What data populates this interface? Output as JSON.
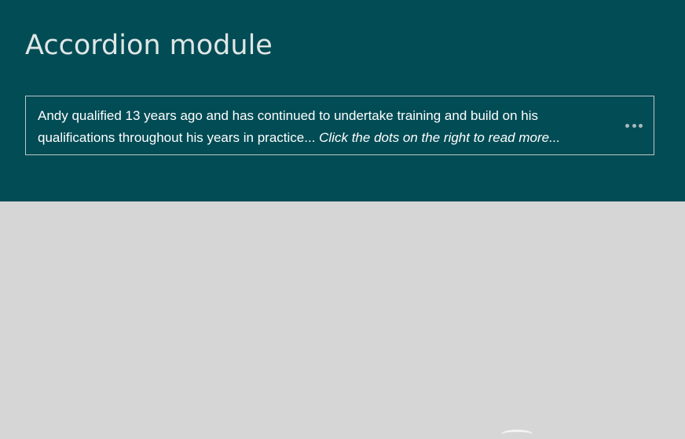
{
  "header": {
    "title": "Accordion module"
  },
  "accordion": {
    "summary": "Andy qualified 13 years ago and has continued to undertake training and build on his qualifications throughout his years in practice...",
    "hint": "Click the dots on the right to read more...",
    "more_icon": "ellipsis-icon"
  },
  "colors": {
    "header_background": "#024c55",
    "page_background": "#d6d6d6",
    "text": "#ffffff"
  }
}
